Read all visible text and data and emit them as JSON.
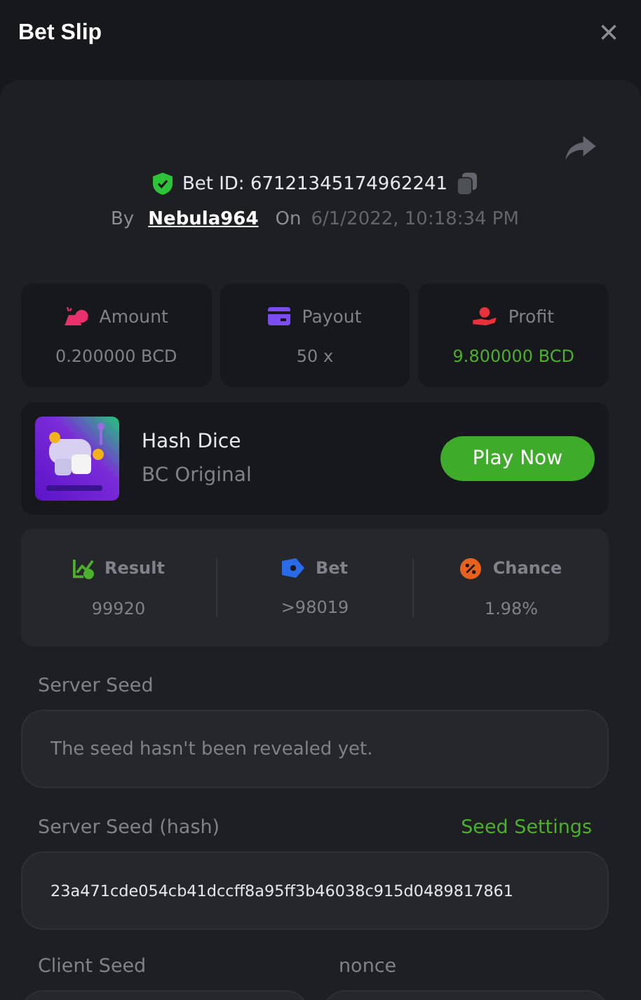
{
  "window": {
    "title": "Bet Slip",
    "close": "×"
  },
  "bet": {
    "verified": true,
    "id_label": "Bet ID: 67121345174962241",
    "by": "By",
    "user": "Nebula964",
    "on": "On",
    "date": "6/1/2022, 10:18:34 PM"
  },
  "summary": [
    {
      "label": "Amount",
      "value": "0.200000 BCD",
      "positive": false
    },
    {
      "label": "Payout",
      "value": "50 x",
      "positive": false
    },
    {
      "label": "Profit",
      "value": "9.800000 BCD",
      "positive": true
    }
  ],
  "game": {
    "name": "Hash Dice",
    "provider": "BC Original",
    "play_button": "Play Now"
  },
  "details": [
    {
      "label": "Result",
      "value": "99920"
    },
    {
      "label": "Bet",
      "value": ">98019"
    },
    {
      "label": "Chance",
      "value": "1.98%"
    }
  ],
  "server_seed": {
    "label": "Server Seed",
    "placeholder": "The seed hasn't been revealed yet."
  },
  "server_seed_hash": {
    "label": "Server Seed (hash)",
    "link": "Seed Settings",
    "value": "23a471cde054cb41dccff8a95ff3b46038c915d0489817861"
  },
  "client_seed": {
    "label": "Client Seed"
  },
  "nonce": {
    "label": "nonce"
  }
}
